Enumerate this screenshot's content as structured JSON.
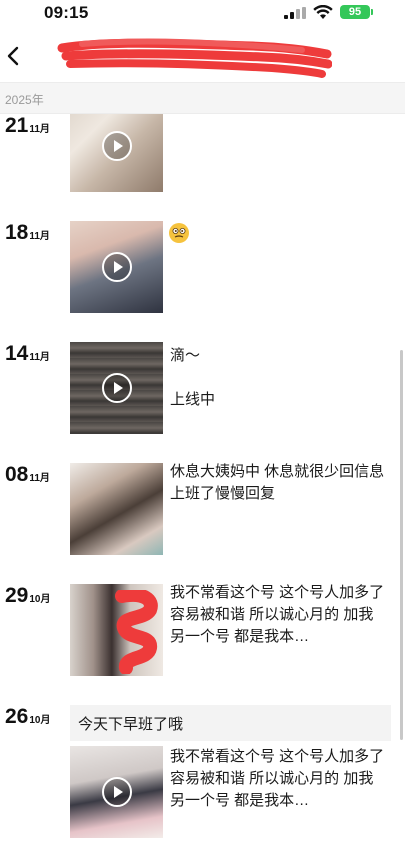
{
  "status_bar": {
    "time": "09:15",
    "battery": "95"
  },
  "nav": {
    "title": ""
  },
  "year_header": {
    "label": "2025年"
  },
  "posts": [
    {
      "day": "21",
      "month": "11月",
      "text": ""
    },
    {
      "day": "18",
      "month": "11月",
      "text": ""
    },
    {
      "day": "14",
      "month": "11月",
      "text_line1": "滴～",
      "text_line2": "上线中"
    },
    {
      "day": "08",
      "month": "11月",
      "text": "休息大姨妈中 休息就很少回信息 上班了慢慢回复"
    },
    {
      "day": "29",
      "month": "10月",
      "text": "我不常看这个号 这个号人加多了 容易被和谐 所以诚心月的 加我另一个号 都是我本…"
    },
    {
      "day": "26",
      "month": "10月",
      "card_text": "今天下早班了哦",
      "text": "我不常看这个号 这个号人加多了 容易被和谐 所以诚心月的 加我另一个号 都是我本…"
    }
  ],
  "colors": {
    "battery": "#34c759",
    "redaction": "#ee3b3b",
    "year_header_bg": "#f5f5f5"
  },
  "icons": [
    "back-arrow-icon",
    "signal-icon",
    "wifi-icon",
    "battery-icon",
    "play-icon",
    "emoji-icon"
  ]
}
